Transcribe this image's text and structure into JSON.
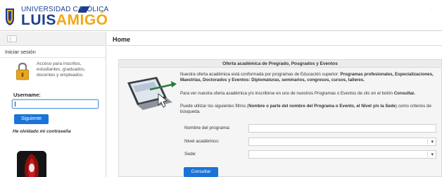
{
  "brand": {
    "university": "UNIVERSIDAD CATÓLICA",
    "name_part1": "LUIS",
    "name_part2": "AMIGÓ",
    "colors": {
      "navy": "#1e3f8f",
      "gold": "#f0a81a",
      "button_blue": "#1a73d8"
    }
  },
  "sidebar": {
    "login_title": "Iniciar sesión",
    "access_text": "Acceso para inscritos, estudiantes, graduados, docentes y empleados.",
    "username_label": "Username:",
    "username_value": "",
    "next_button": "Siguiente",
    "forgot_link": "He olvidado mi contraseña"
  },
  "main": {
    "page_title": "Home",
    "panel": {
      "title": "Oferta académica de Pregrado, Posgrados y Eventos",
      "p1_a": "Nuestra oferta académica está conformada por programas de Educación superior: ",
      "p1_b": "Programas profesionales, Especializaciones, Maestrías, Doctorados y Eventos: Diplomaturas, seminarios, congresos, cursos, talleres.",
      "p2_a": "Para ver nuestra oferta académica y/o inscribirse en uno de nuestros Programas o Eventos de clic en el botón ",
      "p2_b": "Consultar.",
      "p3_a": "Puede utilizar los siguientes filtros (",
      "p3_b": "Nombre o parte del nombre del Programa o Evento, el Nivel y/o la Sede",
      "p3_c": ") como criterios de búsqueda.",
      "filters": {
        "program_label": "Nombre del programa:",
        "program_value": "",
        "level_label": "Nivel académico:",
        "level_value": "",
        "campus_label": "Sede:",
        "campus_value": ""
      },
      "consult_button": "Consultar"
    }
  }
}
